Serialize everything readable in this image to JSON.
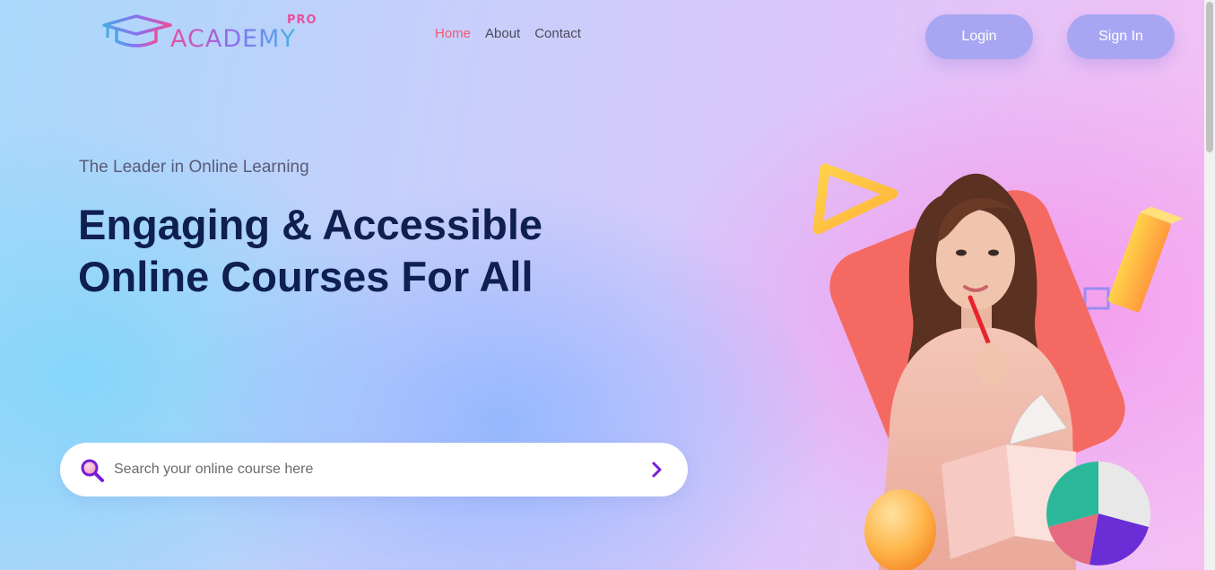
{
  "header": {
    "logo_text": "ACADEMY",
    "logo_badge": "PRO",
    "nav": [
      {
        "label": "Home",
        "active": true
      },
      {
        "label": "About",
        "active": false
      },
      {
        "label": "Contact",
        "active": false
      }
    ],
    "login_label": "Login",
    "signin_label": "Sign In"
  },
  "hero": {
    "tagline": "The Leader in Online Learning",
    "headline": "Engaging & Accessible Online Courses For All"
  },
  "search": {
    "placeholder": "Search your online course here",
    "value": "",
    "icon": "search-icon",
    "submit_icon": "chevron-right-icon"
  },
  "colors": {
    "accent": "#ef5a6f",
    "button": "#a8a6f2",
    "headline": "#0e1f50",
    "search_icon": "#7a1bd6"
  }
}
